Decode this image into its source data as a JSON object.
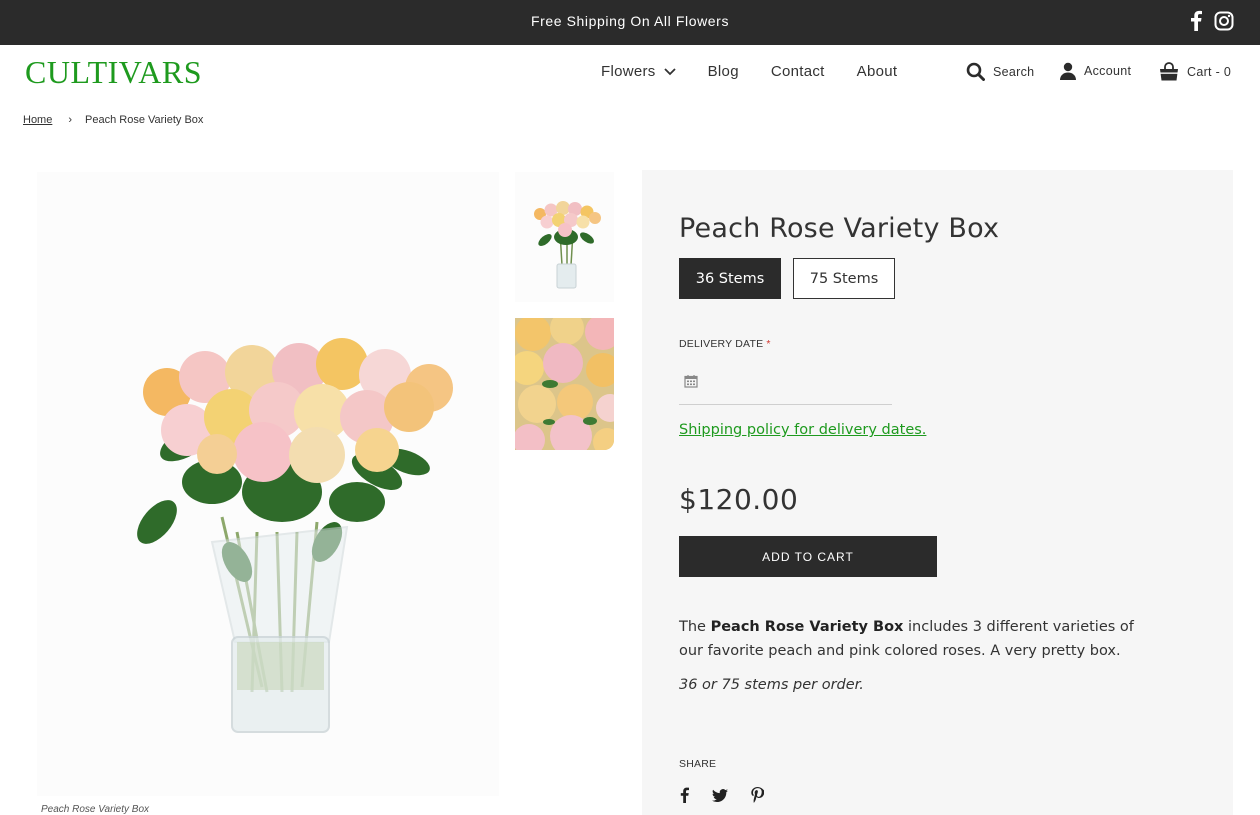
{
  "announcement": {
    "text": "Free Shipping On All Flowers"
  },
  "header": {
    "logo": "CULTIVARS",
    "nav": [
      {
        "label": "Flowers",
        "has_dropdown": true
      },
      {
        "label": "Blog"
      },
      {
        "label": "Contact"
      },
      {
        "label": "About"
      }
    ],
    "search_label": "Search",
    "account_label": "Account",
    "cart_label": "Cart - 0",
    "social_icons": [
      "facebook-icon",
      "instagram-icon"
    ]
  },
  "breadcrumb": {
    "home": "Home",
    "separator": "›",
    "current": "Peach Rose Variety Box"
  },
  "gallery": {
    "caption": "Peach Rose Variety Box"
  },
  "product": {
    "title": "Peach Rose Variety Box",
    "variants": [
      {
        "label": "36 Stems",
        "selected": true
      },
      {
        "label": "75 Stems",
        "selected": false
      }
    ],
    "delivery_label": "DELIVERY DATE",
    "required_marker": "*",
    "shipping_link": "Shipping policy for delivery dates.",
    "price": "$120.00",
    "add_to_cart": "ADD TO CART",
    "description": {
      "intro": "The ",
      "bold": "Peach Rose Variety Box",
      "rest": " includes 3 different varieties of our favorite peach and pink colored roses.  A very pretty box."
    },
    "stems_note": "36 or 75 stems per order.",
    "share_label": "SHARE",
    "share_icons": [
      "facebook-icon",
      "twitter-icon",
      "pinterest-icon"
    ]
  },
  "colors": {
    "brand_green": "#1e9a1e",
    "dark": "#2b2b2b",
    "panel_bg": "#f6f6f6",
    "required_red": "#d0342c"
  }
}
